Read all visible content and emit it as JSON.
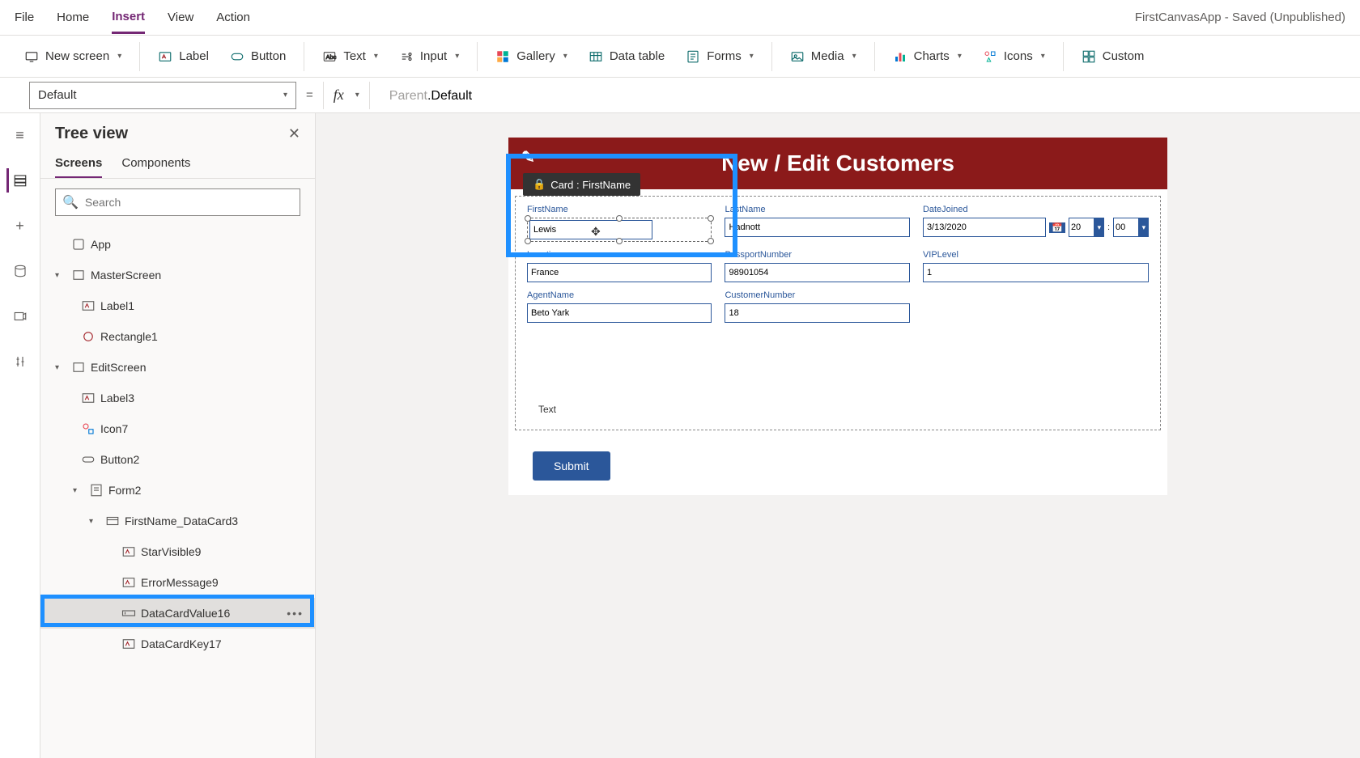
{
  "app_title": "FirstCanvasApp - Saved (Unpublished)",
  "menu": {
    "file": "File",
    "home": "Home",
    "insert": "Insert",
    "view": "View",
    "action": "Action"
  },
  "ribbon": {
    "new_screen": "New screen",
    "label": "Label",
    "button": "Button",
    "text": "Text",
    "input": "Input",
    "gallery": "Gallery",
    "data_table": "Data table",
    "forms": "Forms",
    "media": "Media",
    "charts": "Charts",
    "icons": "Icons",
    "custom": "Custom"
  },
  "formula": {
    "property": "Default",
    "expr_head": "Parent",
    "expr_tail": ".Default"
  },
  "tree": {
    "title": "Tree view",
    "tabs": {
      "screens": "Screens",
      "components": "Components"
    },
    "search_placeholder": "Search",
    "nodes": {
      "app": "App",
      "master": "MasterScreen",
      "label1": "Label1",
      "rectangle1": "Rectangle1",
      "editscreen": "EditScreen",
      "label3": "Label3",
      "icon7": "Icon7",
      "button2": "Button2",
      "form2": "Form2",
      "datacard": "FirstName_DataCard3",
      "starvisible": "StarVisible9",
      "errormsg": "ErrorMessage9",
      "dcvalue": "DataCardValue16",
      "dckey": "DataCardKey17"
    }
  },
  "card_badge": "Card : FirstName",
  "canvas": {
    "title": "New / Edit Customers",
    "fields": {
      "firstname": {
        "label": "FirstName",
        "value": "Lewis"
      },
      "lastname": {
        "label": "LastName",
        "value": "Hadnott"
      },
      "datejoined": {
        "label": "DateJoined",
        "value": "3/13/2020",
        "hour": "20",
        "min": "00"
      },
      "location": {
        "label": "Location",
        "value": "France"
      },
      "passport": {
        "label": "PassportNumber",
        "value": "98901054"
      },
      "vip": {
        "label": "VIPLevel",
        "value": "1"
      },
      "agent": {
        "label": "AgentName",
        "value": "Beto Yark"
      },
      "custno": {
        "label": "CustomerNumber",
        "value": "18"
      }
    },
    "textlabel": "Text",
    "submit": "Submit"
  }
}
